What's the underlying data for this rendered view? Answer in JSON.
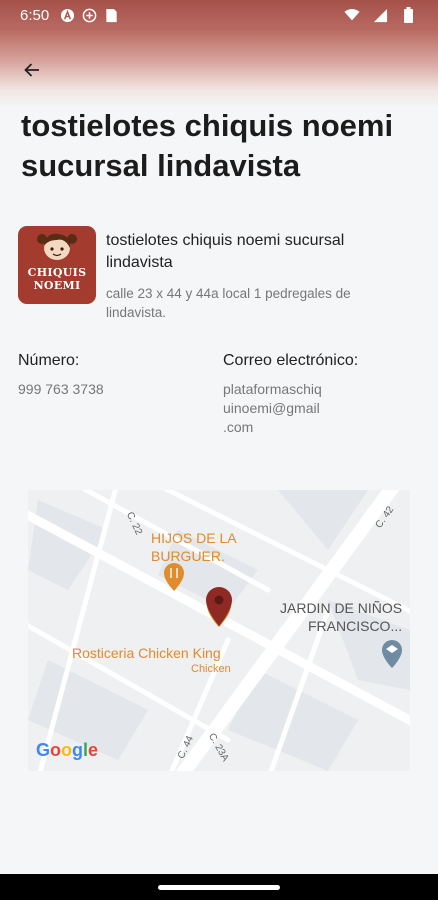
{
  "status_bar": {
    "time": "6:50",
    "icons": [
      "a-icon",
      "hospital-icon",
      "sim-card-icon",
      "wifi-icon",
      "signal-icon",
      "battery-icon"
    ]
  },
  "header": {
    "title": "tostielotes chiquis noemi sucursal lindavista",
    "back_icon": "arrow-left-icon"
  },
  "business": {
    "logo_line1": "CHIQUIS",
    "logo_line2": "NOEMI",
    "name": "tostielotes chiquis noemi sucursal lindavista",
    "address": "calle 23 x 44 y 44a local 1 pedregales de lindavista."
  },
  "contact": {
    "phone_label": "Número:",
    "phone_value": "999 763 3738",
    "email_label": "Correo electrónico:",
    "email_line1": "plataformaschiq",
    "email_line2": "uinoemi@gmail",
    "email_line3": ".com"
  },
  "map": {
    "street_c22": "C. 22",
    "street_c42": "C. 42",
    "street_c44": "C. 44",
    "street_c23a": "C. 23A",
    "poi_burger_line1": "HIJOS DE LA",
    "poi_burger_line2": "BURGUER.",
    "poi_school_line1": "JARDIN DE NIÑOS",
    "poi_school_line2": "FRANCISCO...",
    "poi_chicken": "Rosticeria Chicken King",
    "poi_chicken_sub": "Chicken",
    "google": [
      "G",
      "o",
      "o",
      "g",
      "l",
      "e"
    ],
    "colors": {
      "pin": "#8e2a23",
      "poi_food": "#e08b2c",
      "poi_school": "#6f8ca3"
    }
  }
}
